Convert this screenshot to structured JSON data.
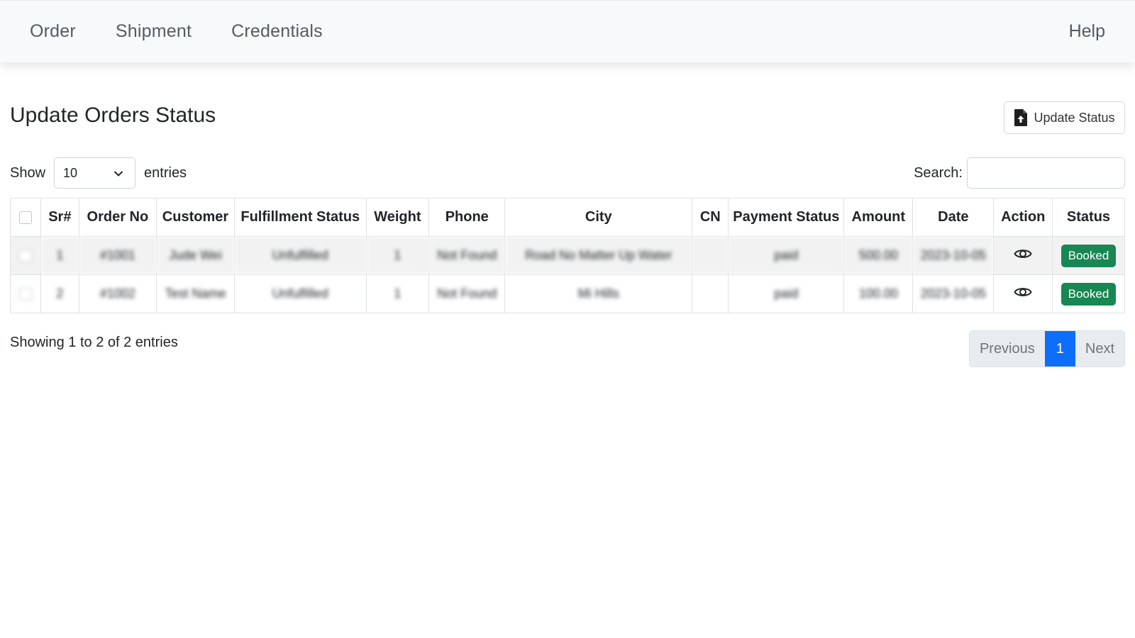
{
  "nav": {
    "items": [
      {
        "label": "Order"
      },
      {
        "label": "Shipment"
      },
      {
        "label": "Credentials"
      }
    ],
    "help_label": "Help"
  },
  "page": {
    "title": "Update Orders Status",
    "update_button_label": "Update Status",
    "update_button_icon": "file-upload-icon"
  },
  "table_controls": {
    "show_label": "Show",
    "entries_value": "10",
    "entries_label": "entries",
    "search_label": "Search:",
    "search_value": ""
  },
  "table": {
    "columns": [
      "Sr#",
      "Order No",
      "Customer",
      "Fulfillment Status",
      "Weight",
      "Phone",
      "City",
      "CN",
      "Payment Status",
      "Amount",
      "Date",
      "Action",
      "Status"
    ],
    "rows": [
      {
        "sr": "1",
        "order_no": "#1001",
        "customer": "Jude Wei",
        "fulfillment": "Unfulfilled",
        "weight": "1",
        "phone": "Not Found",
        "city": "Road No Matter Up Water",
        "cn": "",
        "payment": "paid",
        "amount": "500.00",
        "date": "2023-10-05",
        "action_icon": "eye-icon",
        "status": "Booked"
      },
      {
        "sr": "2",
        "order_no": "#1002",
        "customer": "Test Name",
        "fulfillment": "Unfulfilled",
        "weight": "1",
        "phone": "Not Found",
        "city": "Mi Hills",
        "cn": "",
        "payment": "paid",
        "amount": "100.00",
        "date": "2023-10-05",
        "action_icon": "eye-icon",
        "status": "Booked"
      }
    ],
    "status_color": "#198754"
  },
  "footer": {
    "info": "Showing 1 to 2 of 2 entries",
    "previous_label": "Previous",
    "current_page": "1",
    "next_label": "Next",
    "active_color": "#0d6efd"
  }
}
